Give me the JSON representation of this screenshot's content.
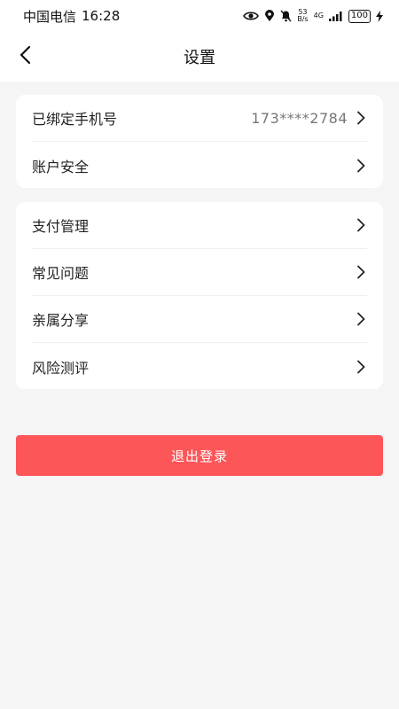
{
  "status_bar": {
    "carrier": "中国电信",
    "time": "16:28",
    "net_speed_value": "53",
    "net_speed_unit": "B/s",
    "network_type": "4G",
    "battery": "100"
  },
  "header": {
    "title": "设置",
    "back_icon": "chevron-left-icon"
  },
  "account_section": {
    "items": [
      {
        "label": "已绑定手机号",
        "value": "173****2784"
      },
      {
        "label": "账户安全",
        "value": ""
      }
    ]
  },
  "settings_section": {
    "items": [
      {
        "label": "支付管理"
      },
      {
        "label": "常见问题"
      },
      {
        "label": "亲属分享"
      },
      {
        "label": "风险测评"
      }
    ]
  },
  "logout": {
    "label": "退出登录"
  },
  "colors": {
    "accent": "#fd5658",
    "background": "#f5f5f5",
    "card": "#ffffff"
  }
}
